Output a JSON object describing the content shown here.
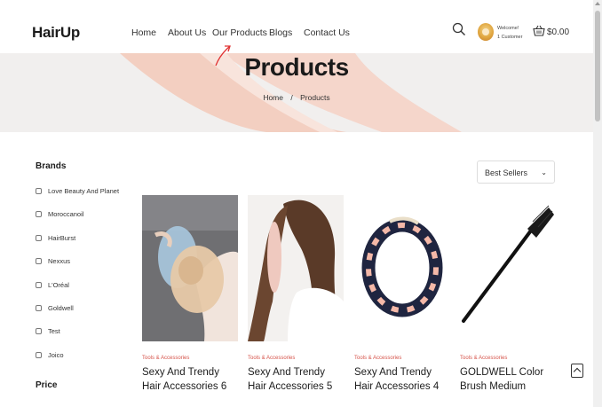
{
  "header": {
    "logo": "HairUp",
    "nav": [
      {
        "label": "Home"
      },
      {
        "label": "About Us"
      },
      {
        "label": "Our Products"
      },
      {
        "label": "Blogs"
      },
      {
        "label": "Contact Us"
      }
    ],
    "welcome_line1": "Welcome!",
    "welcome_line2": "1 Customer",
    "cart_total": "$0.00",
    "icons": {
      "search": "search-icon",
      "cart": "basket-icon",
      "avatar": "user-avatar"
    }
  },
  "banner": {
    "title": "Products",
    "breadcrumb": {
      "home": "Home",
      "separator": "/",
      "current": "Products"
    }
  },
  "sidebar": {
    "brands_title": "Brands",
    "brands": [
      {
        "label": "Love Beauty And Planet"
      },
      {
        "label": "Moroccanoil"
      },
      {
        "label": "HairBurst"
      },
      {
        "label": "Nexxus"
      },
      {
        "label": "L'Oréal"
      },
      {
        "label": "Goldwell"
      },
      {
        "label": "Test"
      },
      {
        "label": "Joico"
      }
    ],
    "price_title": "Price"
  },
  "sort": {
    "selected": "Best Sellers"
  },
  "products": [
    {
      "category": "Tools & Accessories",
      "title": "Sexy And Trendy Hair Accessories 6"
    },
    {
      "category": "Tools & Accessories",
      "title": "Sexy And Trendy Hair Accessories 5"
    },
    {
      "category": "Tools & Accessories",
      "title": "Sexy And Trendy Hair Accessories 4"
    },
    {
      "category": "Tools & Accessories",
      "title": "GOLDWELL Color Brush Medium"
    }
  ],
  "colors": {
    "accent": "#d6534a",
    "banner_bg": "#f1efee",
    "banner_swirl": "#f2c6b6",
    "annotation_arrow": "#e03030"
  }
}
